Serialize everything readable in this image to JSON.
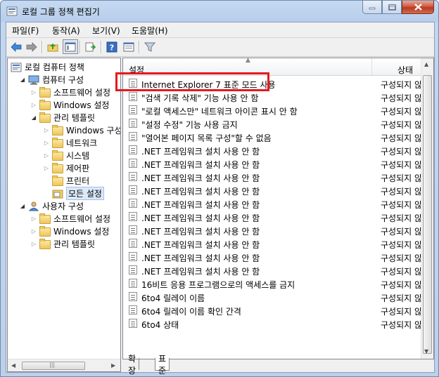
{
  "window": {
    "title": "로컬 그룹 정책 편집기"
  },
  "menubar": [
    "파일(F)",
    "동작(A)",
    "보기(V)",
    "도움말(H)"
  ],
  "tree": {
    "root": "로컬 컴퓨터 정책",
    "items": [
      {
        "label": "컴퓨터 구성",
        "level": 1,
        "expanded": true,
        "icon": "computer-icon"
      },
      {
        "label": "소프트웨어 설정",
        "level": 2,
        "expanded": false,
        "icon": "folder-icon"
      },
      {
        "label": "Windows 설정",
        "level": 2,
        "expanded": false,
        "icon": "folder-icon"
      },
      {
        "label": "관리 템플릿",
        "level": 2,
        "expanded": true,
        "icon": "folder-icon"
      },
      {
        "label": "Windows 구성",
        "level": 3,
        "expanded": false,
        "icon": "folder-icon"
      },
      {
        "label": "네트워크",
        "level": 3,
        "expanded": false,
        "icon": "folder-icon"
      },
      {
        "label": "시스템",
        "level": 3,
        "expanded": false,
        "icon": "folder-icon"
      },
      {
        "label": "제어판",
        "level": 3,
        "expanded": false,
        "icon": "folder-icon"
      },
      {
        "label": "프린터",
        "level": 3,
        "expanded": null,
        "icon": "folder-icon"
      },
      {
        "label": "모든 설정",
        "level": 3,
        "expanded": null,
        "icon": "all-settings-icon",
        "selected": true
      },
      {
        "label": "사용자 구성",
        "level": 1,
        "expanded": true,
        "icon": "user-icon"
      },
      {
        "label": "소프트웨어 설정",
        "level": 2,
        "expanded": false,
        "icon": "folder-icon"
      },
      {
        "label": "Windows 설정",
        "level": 2,
        "expanded": false,
        "icon": "folder-icon"
      },
      {
        "label": "관리 템플릿",
        "level": 2,
        "expanded": false,
        "icon": "folder-icon"
      }
    ]
  },
  "list": {
    "columns": {
      "setting": "설정",
      "state": "상태"
    },
    "rows": [
      {
        "name": "Internet Explorer 7 표준 모드 사용",
        "state": "구성되지 않음"
      },
      {
        "name": "\"검색 기록 삭제\" 기능 사용 안 함",
        "state": "구성되지 않음"
      },
      {
        "name": "\"로컬 액세스만\" 네트워크 아이콘 표시 안 함",
        "state": "구성되지 않음"
      },
      {
        "name": "\"설정 수정\" 기능 사용 금지",
        "state": "구성되지 않음"
      },
      {
        "name": "\"열어본 페이지 목록 구성\"할 수 없음",
        "state": "구성되지 않음"
      },
      {
        "name": ".NET 프레임워크 설치 사용 안 함",
        "state": "구성되지 않음"
      },
      {
        "name": ".NET 프레임워크 설치 사용 안 함",
        "state": "구성되지 않음"
      },
      {
        "name": ".NET 프레임워크 설치 사용 안 함",
        "state": "구성되지 않음"
      },
      {
        "name": ".NET 프레임워크 설치 사용 안 함",
        "state": "구성되지 않음"
      },
      {
        "name": ".NET 프레임워크 설치 사용 안 함",
        "state": "구성되지 않음"
      },
      {
        "name": ".NET 프레임워크 설치 사용 안 함",
        "state": "구성되지 않음"
      },
      {
        "name": ".NET 프레임워크 설치 사용 안 함",
        "state": "구성되지 않음"
      },
      {
        "name": ".NET 프레임워크 설치 사용 안 함",
        "state": "구성되지 않음"
      },
      {
        "name": ".NET 프레임워크 설치 사용 안 함",
        "state": "구성되지 않음"
      },
      {
        "name": ".NET 프레임워크 설치 사용 안 함",
        "state": "구성되지 않음"
      },
      {
        "name": "16비트 응용 프로그램으로의 액세스를 금지",
        "state": "구성되지 않음"
      },
      {
        "name": "6to4 릴레이 이름",
        "state": "구성되지 않음"
      },
      {
        "name": "6to4 릴레이 이름 확인 간격",
        "state": "구성되지 않음"
      },
      {
        "name": "6to4 상태",
        "state": "구성되지 않음"
      }
    ]
  },
  "tabs": [
    "확장",
    "표준"
  ],
  "colors": {
    "highlight_box": "#e8181d",
    "selection": "#dbe9f9"
  }
}
